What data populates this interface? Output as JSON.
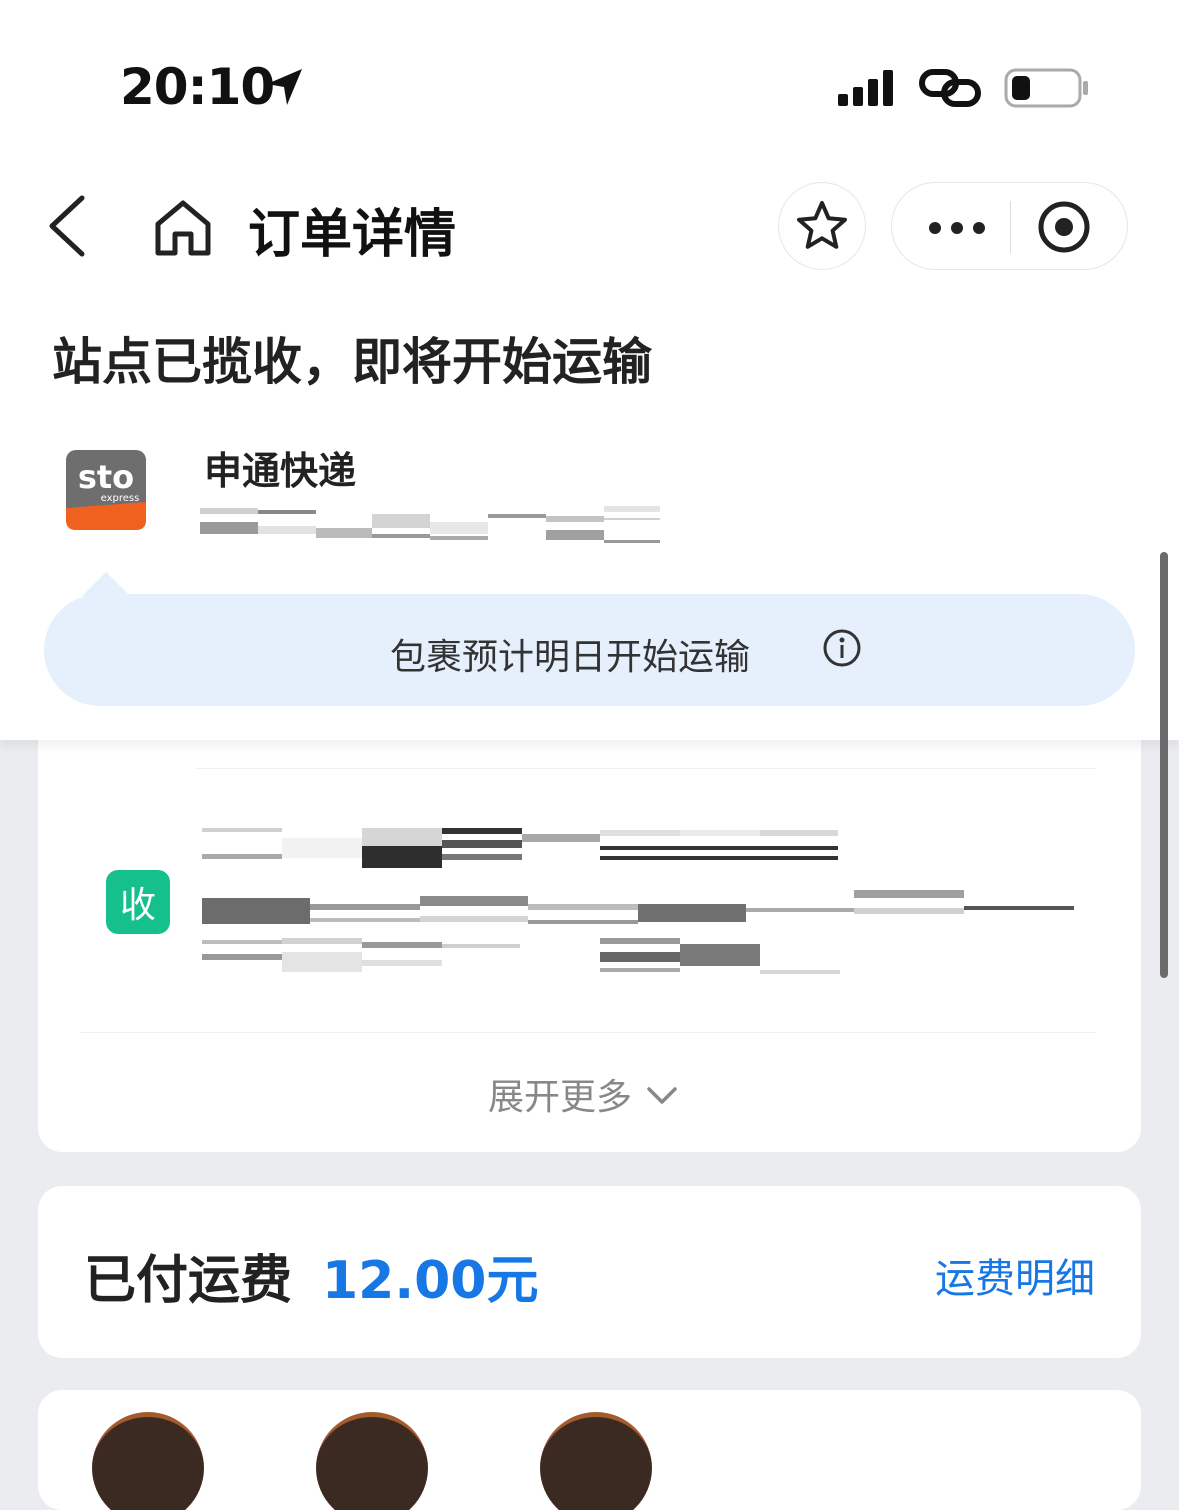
{
  "status_bar": {
    "time": "20:10",
    "icons": [
      "location-arrow-icon",
      "signal-bars-icon",
      "link-icon",
      "battery-icon"
    ]
  },
  "nav": {
    "title": "订单详情",
    "icons": [
      "back-chevron-icon",
      "home-icon",
      "star-icon",
      "more-dots-icon",
      "miniprogram-close-icon"
    ]
  },
  "order": {
    "status_headline": "站点已揽收，即将开始运输",
    "courier_name": "申通快递",
    "courier_logo_text": "sto express",
    "tip_text": "包裹预计明日开始运输"
  },
  "address_card": {
    "badge_label": "收",
    "expand_label": "展开更多"
  },
  "fee_card": {
    "label": "已付运费",
    "amount": "12.00元",
    "detail_link": "运费明细"
  },
  "colors": {
    "accent_blue": "#1677e5",
    "tip_bg": "#e6f0fd",
    "receive_badge": "#16c08c",
    "sto_orange": "#f0601e",
    "page_bg": "#eaecf0"
  }
}
